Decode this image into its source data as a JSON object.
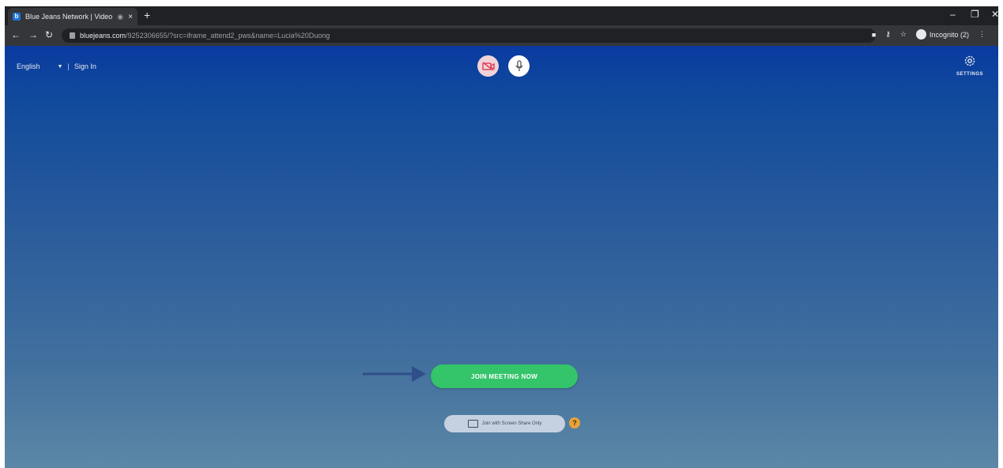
{
  "browser": {
    "tab_title": "Blue Jeans Network | Video",
    "tab_close": "×",
    "new_tab": "+",
    "url_host": "bluejeans.com",
    "url_path": "/9252306655/?src=iframe_attend2_pws&name=Lucia%20Duong",
    "incognito_label": "Incognito (2)",
    "window_min": "–",
    "window_max": "❐",
    "window_close": "✕"
  },
  "header": {
    "language": "English",
    "separator": "|",
    "sign_in": "Sign In",
    "settings_label": "SETTINGS"
  },
  "main": {
    "join_button": "JOIN MEETING NOW",
    "screen_share_button": "Join with Screen Share Only",
    "help_badge": "?"
  },
  "colors": {
    "join_green": "#34c46a",
    "help_orange": "#e8a23a",
    "camera_muted": "#e0425a"
  }
}
